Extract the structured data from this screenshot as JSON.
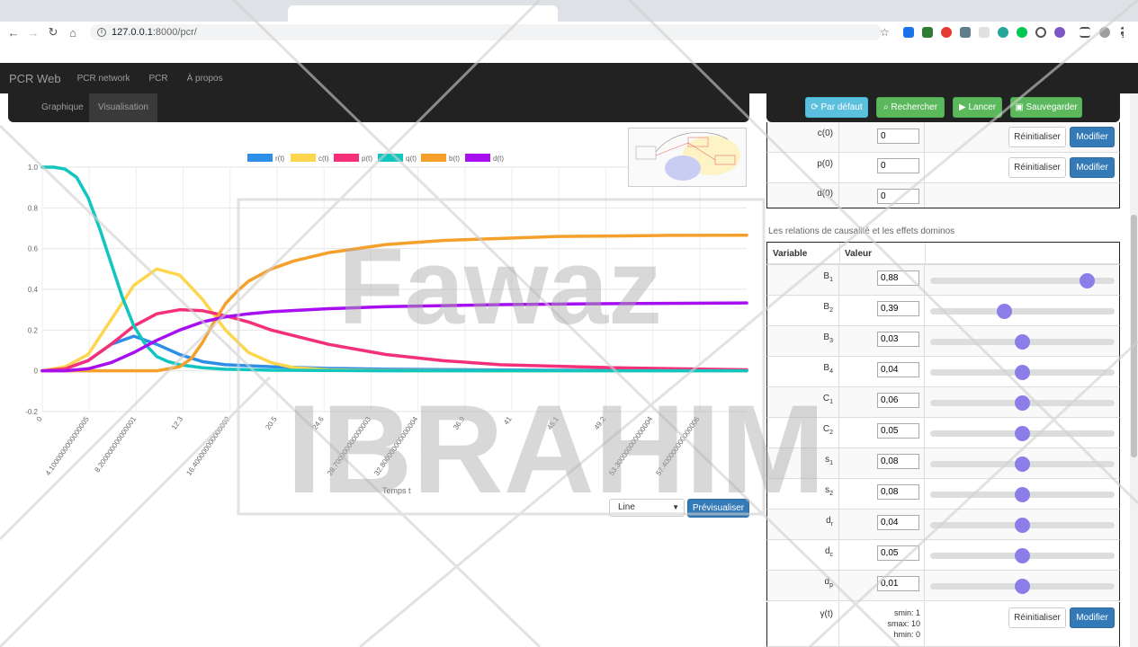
{
  "browser": {
    "url_host": "127.0.0.1",
    "url_path": ":8000/pcr/"
  },
  "navbar": {
    "brand": "PCR Web",
    "links": [
      "PCR network",
      "PCR",
      "À propos"
    ]
  },
  "subtabs": [
    "Graphique",
    "Visualisation"
  ],
  "actions": {
    "default": "Par défaut",
    "search": "Rechercher",
    "launch": "Lancer",
    "save": "Sauvegarder"
  },
  "init_rows": [
    {
      "label": "c(0)",
      "value": "0",
      "reset": "Réinitialiser",
      "modify": "Modifier"
    },
    {
      "label": "p(0)",
      "value": "0",
      "reset": "Réinitialiser",
      "modify": "Modifier"
    },
    {
      "label": "d(0)",
      "value": "0"
    }
  ],
  "relations_title": "Les relations de causalité et les effets dominos",
  "param_table": {
    "head_var": "Variable",
    "head_val": "Valeur",
    "rows": [
      {
        "base": "B",
        "sub": "1",
        "value": "0,88",
        "level": 0.85
      },
      {
        "base": "B",
        "sub": "2",
        "value": "0,39",
        "level": 0.4
      },
      {
        "base": "B",
        "sub": "3",
        "value": "0,03",
        "level": 0.5
      },
      {
        "base": "B",
        "sub": "4",
        "value": "0,04",
        "level": 0.5
      },
      {
        "base": "C",
        "sub": "1",
        "value": "0,06",
        "level": 0.5
      },
      {
        "base": "C",
        "sub": "2",
        "value": "0,05",
        "level": 0.5
      },
      {
        "base": "s",
        "sub": "1",
        "value": "0,08",
        "level": 0.5
      },
      {
        "base": "s",
        "sub": "2",
        "value": "0,08",
        "level": 0.5
      },
      {
        "base": "d",
        "sub": "r",
        "value": "0,04",
        "level": 0.5
      },
      {
        "base": "d",
        "sub": "c",
        "value": "0,05",
        "level": 0.5
      },
      {
        "base": "d",
        "sub": "p",
        "value": "0,01",
        "level": 0.5
      }
    ],
    "gamma": {
      "label": "γ(t)",
      "smin": "smin: 1",
      "smax": "smax: 10",
      "hmin": "hmin: 0",
      "reset": "Réinitialiser",
      "modify": "Modifier"
    }
  },
  "chart_controls": {
    "select_value": "Line",
    "preview_label": "Prévisualiser"
  },
  "watermark": {
    "line1": "Fawaz",
    "line2": "IBRAHIM"
  },
  "colors": {
    "r": "#2e8fe8",
    "c": "#fdd64d",
    "p": "#f4307a",
    "q": "#12c6bf",
    "b": "#f5a02a",
    "d": "#a70ff0"
  },
  "chart_data": {
    "type": "line",
    "xlabel": "Temps t",
    "ylabel": "",
    "xlim": [
      0,
      61.5
    ],
    "ylim": [
      -0.2,
      1.0
    ],
    "x_tick_labels": [
      "0",
      "4.1000000000000005",
      "8.200000000000001",
      "12.3",
      "16.400000000000002",
      "20.5",
      "24.6",
      "28.700000000000003",
      "32.800000000000004",
      "36.9",
      "41",
      "45.1",
      "49.2",
      "53.300000000000004",
      "57.400000000000006"
    ],
    "y_tick_labels": [
      "-0.2",
      "0",
      "0.2",
      "0.4",
      "0.6",
      "0.8",
      "1.0"
    ],
    "series": [
      {
        "name": "r(t)",
        "x": [
          0,
          2,
          4,
          6,
          8,
          10,
          12,
          14,
          16,
          20,
          25,
          30,
          40,
          50,
          61.5
        ],
        "values": [
          0,
          0.01,
          0.05,
          0.13,
          0.17,
          0.13,
          0.08,
          0.045,
          0.03,
          0.02,
          0.012,
          0.008,
          0.004,
          0.002,
          0.001
        ]
      },
      {
        "name": "c(t)",
        "x": [
          0,
          2,
          4,
          6,
          8,
          10,
          12,
          14,
          16,
          18,
          20,
          22,
          25,
          30,
          40,
          61.5
        ],
        "values": [
          0,
          0.02,
          0.08,
          0.25,
          0.42,
          0.5,
          0.47,
          0.35,
          0.2,
          0.09,
          0.04,
          0.015,
          0.005,
          0.002,
          0,
          0
        ]
      },
      {
        "name": "p(t)",
        "x": [
          0,
          2,
          4,
          6,
          8,
          10,
          12,
          14,
          16,
          18,
          20,
          25,
          30,
          35,
          40,
          50,
          61.5
        ],
        "values": [
          0,
          0.01,
          0.05,
          0.13,
          0.22,
          0.28,
          0.3,
          0.295,
          0.27,
          0.24,
          0.2,
          0.13,
          0.08,
          0.05,
          0.03,
          0.015,
          0.005
        ]
      },
      {
        "name": "q(t)",
        "x": [
          0,
          1,
          2,
          3,
          4,
          5,
          6,
          7,
          8,
          9,
          10,
          11,
          12,
          14,
          16,
          20,
          30,
          61.5
        ],
        "values": [
          1,
          1,
          0.99,
          0.95,
          0.85,
          0.7,
          0.53,
          0.36,
          0.22,
          0.13,
          0.07,
          0.045,
          0.03,
          0.015,
          0.008,
          0.003,
          0,
          0
        ]
      },
      {
        "name": "b(t)",
        "x": [
          0,
          10,
          12,
          13,
          14,
          15,
          16,
          17,
          18,
          20,
          22,
          25,
          30,
          35,
          40,
          45,
          50,
          55,
          61.5
        ],
        "values": [
          0,
          0,
          0.02,
          0.06,
          0.14,
          0.24,
          0.33,
          0.39,
          0.44,
          0.5,
          0.54,
          0.58,
          0.62,
          0.64,
          0.65,
          0.66,
          0.662,
          0.665,
          0.666
        ]
      },
      {
        "name": "d(t)",
        "x": [
          0,
          2,
          4,
          6,
          8,
          10,
          12,
          14,
          16,
          18,
          20,
          25,
          30,
          35,
          40,
          50,
          61.5
        ],
        "values": [
          0,
          0,
          0.01,
          0.04,
          0.09,
          0.15,
          0.2,
          0.24,
          0.265,
          0.28,
          0.29,
          0.305,
          0.315,
          0.32,
          0.325,
          0.33,
          0.333
        ]
      }
    ]
  }
}
